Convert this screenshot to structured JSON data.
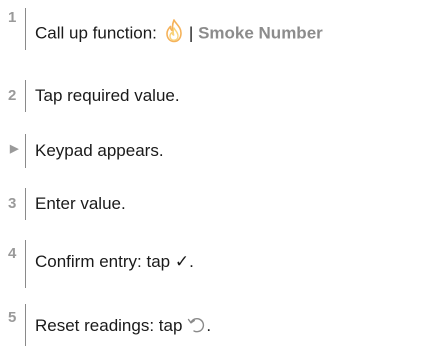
{
  "steps": [
    {
      "marker": "1",
      "text": "Call up function:",
      "separator": "|",
      "function_name": "Smoke Number",
      "icon": "flame-icon"
    },
    {
      "marker": "2",
      "text": "Tap required value."
    },
    {
      "marker": "▶",
      "text": "Keypad appears."
    },
    {
      "marker": "3",
      "text": "Enter value."
    },
    {
      "marker": "4",
      "text": "Confirm entry: tap ✓."
    },
    {
      "marker": "5",
      "text": "Reset readings: tap",
      "end": ".",
      "icon": "reset-icon"
    }
  ],
  "colors": {
    "marker": "#9a9a9a",
    "bar": "#8a8a8a",
    "text": "#1a1a1a",
    "function_name": "#8c8c8c",
    "flame_outer": "#f5b25a",
    "flame_inner": "#f8d37a",
    "reset_icon": "#8a8a8a"
  }
}
